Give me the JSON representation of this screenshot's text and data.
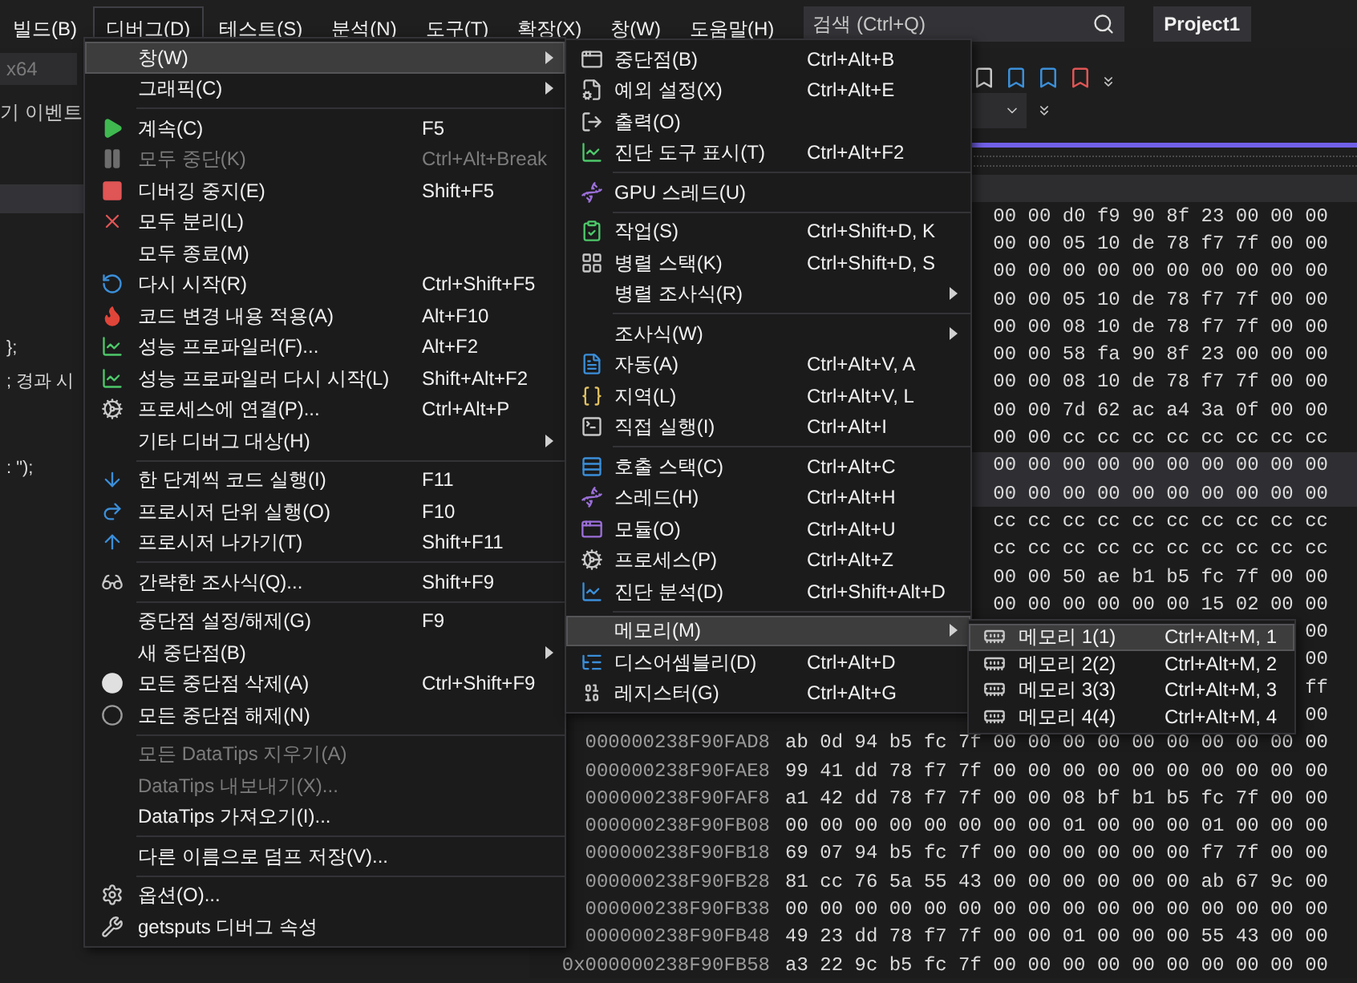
{
  "menubar": {
    "items": [
      {
        "label": "빌드(B)",
        "selected": false
      },
      {
        "label": "디버그(D)",
        "selected": true
      },
      {
        "label": "테스트(S)",
        "selected": false
      },
      {
        "label": "분석(N)",
        "selected": false
      },
      {
        "label": "도구(T)",
        "selected": false
      },
      {
        "label": "확장(X)",
        "selected": false
      },
      {
        "label": "창(W)",
        "selected": false
      },
      {
        "label": "도움말(H)",
        "selected": false
      }
    ],
    "search": {
      "placeholder": "검색 (Ctrl+Q)"
    },
    "project": "Project1"
  },
  "editor": {
    "platform": "x64",
    "event_label": "기 이벤트",
    "code_lines": [
      "};",
      "; 경과 시",
      ": \");"
    ]
  },
  "debug_menu": {
    "items": [
      {
        "kind": "item",
        "label": "창(W)",
        "submenu": true,
        "selected": true,
        "disabled": false
      },
      {
        "kind": "item",
        "label": "그래픽(C)",
        "submenu": true,
        "selected": false,
        "disabled": false
      },
      {
        "kind": "separator"
      },
      {
        "kind": "item",
        "label": "계속(C)",
        "shortcut": "F5",
        "submenu": false,
        "selected": false,
        "disabled": false
      },
      {
        "kind": "item",
        "label": "모두 중단(K)",
        "shortcut": "Ctrl+Alt+Break",
        "submenu": false,
        "selected": false,
        "disabled": true
      },
      {
        "kind": "item",
        "label": "디버깅 중지(E)",
        "shortcut": "Shift+F5",
        "submenu": false,
        "selected": false,
        "disabled": false
      },
      {
        "kind": "item",
        "label": "모두 분리(L)",
        "submenu": false,
        "selected": false,
        "disabled": false
      },
      {
        "kind": "item",
        "label": "모두 종료(M)",
        "submenu": false,
        "selected": false,
        "disabled": false
      },
      {
        "kind": "item",
        "label": "다시 시작(R)",
        "shortcut": "Ctrl+Shift+F5",
        "submenu": false,
        "selected": false,
        "disabled": false
      },
      {
        "kind": "item",
        "label": "코드 변경 내용 적용(A)",
        "shortcut": "Alt+F10",
        "submenu": false,
        "selected": false,
        "disabled": false
      },
      {
        "kind": "item",
        "label": "성능 프로파일러(F)...",
        "shortcut": "Alt+F2",
        "submenu": false,
        "selected": false,
        "disabled": false
      },
      {
        "kind": "item",
        "label": "성능 프로파일러 다시 시작(L)",
        "shortcut": "Shift+Alt+F2",
        "submenu": false,
        "selected": false,
        "disabled": false
      },
      {
        "kind": "item",
        "label": "프로세스에 연결(P)...",
        "shortcut": "Ctrl+Alt+P",
        "submenu": false,
        "selected": false,
        "disabled": false
      },
      {
        "kind": "item",
        "label": "기타 디버그 대상(H)",
        "submenu": true,
        "selected": false,
        "disabled": false
      },
      {
        "kind": "separator"
      },
      {
        "kind": "item",
        "label": "한 단계씩 코드 실행(I)",
        "shortcut": "F11",
        "submenu": false,
        "selected": false,
        "disabled": false
      },
      {
        "kind": "item",
        "label": "프로시저 단위 실행(O)",
        "shortcut": "F10",
        "submenu": false,
        "selected": false,
        "disabled": false
      },
      {
        "kind": "item",
        "label": "프로시저 나가기(T)",
        "shortcut": "Shift+F11",
        "submenu": false,
        "selected": false,
        "disabled": false
      },
      {
        "kind": "separator"
      },
      {
        "kind": "item",
        "label": "간략한 조사식(Q)...",
        "shortcut": "Shift+F9",
        "submenu": false,
        "selected": false,
        "disabled": false
      },
      {
        "kind": "separator"
      },
      {
        "kind": "item",
        "label": "중단점 설정/해제(G)",
        "shortcut": "F9",
        "submenu": false,
        "selected": false,
        "disabled": false
      },
      {
        "kind": "item",
        "label": "새 중단점(B)",
        "submenu": true,
        "selected": false,
        "disabled": false
      },
      {
        "kind": "item",
        "label": "모든 중단점 삭제(A)",
        "shortcut": "Ctrl+Shift+F9",
        "submenu": false,
        "selected": false,
        "disabled": false
      },
      {
        "kind": "item",
        "label": "모든 중단점 해제(N)",
        "submenu": false,
        "selected": false,
        "disabled": false
      },
      {
        "kind": "separator"
      },
      {
        "kind": "item",
        "label": "모든 DataTips 지우기(A)",
        "submenu": false,
        "selected": false,
        "disabled": true
      },
      {
        "kind": "item",
        "label": "DataTips 내보내기(X)...",
        "submenu": false,
        "selected": false,
        "disabled": true
      },
      {
        "kind": "item",
        "label": "DataTips 가져오기(I)...",
        "submenu": false,
        "selected": false,
        "disabled": false
      },
      {
        "kind": "separator"
      },
      {
        "kind": "item",
        "label": "다른 이름으로 덤프 저장(V)...",
        "submenu": false,
        "selected": false,
        "disabled": false
      },
      {
        "kind": "separator"
      },
      {
        "kind": "item",
        "label": "옵션(O)...",
        "submenu": false,
        "selected": false,
        "disabled": false
      },
      {
        "kind": "item",
        "label": "getsputs 디버그 속성",
        "submenu": false,
        "selected": false,
        "disabled": false
      }
    ]
  },
  "window_menu": {
    "items": [
      {
        "kind": "item",
        "label": "중단점(B)",
        "shortcut": "Ctrl+Alt+B",
        "submenu": false,
        "selected": false
      },
      {
        "kind": "item",
        "label": "예외 설정(X)",
        "shortcut": "Ctrl+Alt+E",
        "submenu": false,
        "selected": false
      },
      {
        "kind": "item",
        "label": "출력(O)",
        "submenu": false,
        "selected": false
      },
      {
        "kind": "item",
        "label": "진단 도구 표시(T)",
        "shortcut": "Ctrl+Alt+F2",
        "submenu": false,
        "selected": false
      },
      {
        "kind": "separator"
      },
      {
        "kind": "item",
        "label": "GPU 스레드(U)",
        "submenu": false,
        "selected": false
      },
      {
        "kind": "separator"
      },
      {
        "kind": "item",
        "label": "작업(S)",
        "shortcut": "Ctrl+Shift+D, K",
        "submenu": false,
        "selected": false
      },
      {
        "kind": "item",
        "label": "병렬 스택(K)",
        "shortcut": "Ctrl+Shift+D, S",
        "submenu": false,
        "selected": false
      },
      {
        "kind": "item",
        "label": "병렬 조사식(R)",
        "submenu": true,
        "selected": false
      },
      {
        "kind": "separator"
      },
      {
        "kind": "item",
        "label": "조사식(W)",
        "submenu": true,
        "selected": false
      },
      {
        "kind": "item",
        "label": "자동(A)",
        "shortcut": "Ctrl+Alt+V, A",
        "submenu": false,
        "selected": false
      },
      {
        "kind": "item",
        "label": "지역(L)",
        "shortcut": "Ctrl+Alt+V, L",
        "submenu": false,
        "selected": false
      },
      {
        "kind": "item",
        "label": "직접 실행(I)",
        "shortcut": "Ctrl+Alt+I",
        "submenu": false,
        "selected": false
      },
      {
        "kind": "separator"
      },
      {
        "kind": "item",
        "label": "호출 스택(C)",
        "shortcut": "Ctrl+Alt+C",
        "submenu": false,
        "selected": false
      },
      {
        "kind": "item",
        "label": "스레드(H)",
        "shortcut": "Ctrl+Alt+H",
        "submenu": false,
        "selected": false
      },
      {
        "kind": "item",
        "label": "모듈(O)",
        "shortcut": "Ctrl+Alt+U",
        "submenu": false,
        "selected": false
      },
      {
        "kind": "item",
        "label": "프로세스(P)",
        "shortcut": "Ctrl+Alt+Z",
        "submenu": false,
        "selected": false
      },
      {
        "kind": "item",
        "label": "진단 분석(D)",
        "shortcut": "Ctrl+Shift+Alt+D",
        "submenu": false,
        "selected": false
      },
      {
        "kind": "separator"
      },
      {
        "kind": "item",
        "label": "메모리(M)",
        "submenu": true,
        "selected": true
      },
      {
        "kind": "item",
        "label": "디스어셈블리(D)",
        "shortcut": "Ctrl+Alt+D",
        "submenu": false,
        "selected": false
      },
      {
        "kind": "item",
        "label": "레지스터(G)",
        "shortcut": "Ctrl+Alt+G",
        "submenu": false,
        "selected": false
      }
    ]
  },
  "memory_menu": {
    "items": [
      {
        "kind": "item",
        "label": "메모리 1(1)",
        "shortcut": "Ctrl+Alt+M, 1",
        "selected": true
      },
      {
        "kind": "item",
        "label": "메모리 2(2)",
        "shortcut": "Ctrl+Alt+M, 2",
        "selected": false
      },
      {
        "kind": "item",
        "label": "메모리 3(3)",
        "shortcut": "Ctrl+Alt+M, 3",
        "selected": false
      },
      {
        "kind": "item",
        "label": "메모리 4(4)",
        "shortcut": "Ctrl+Alt+M, 4",
        "selected": false
      }
    ]
  },
  "memory": {
    "rows": [
      {
        "bytes": "00 00 d0 f9 90 8f 23 00 00 00",
        "selected": false
      },
      {
        "bytes": "00 00 05 10 de 78 f7 7f 00 00",
        "selected": false
      },
      {
        "bytes": "00 00 00 00 00 00 00 00 00 00",
        "selected": false
      },
      {
        "bytes": "00 00 05 10 de 78 f7 7f 00 00",
        "selected": false
      },
      {
        "bytes": "00 00 08 10 de 78 f7 7f 00 00",
        "selected": false
      },
      {
        "bytes": "00 00 58 fa 90 8f 23 00 00 00",
        "selected": false
      },
      {
        "bytes": "00 00 08 10 de 78 f7 7f 00 00",
        "selected": false
      },
      {
        "bytes": "00 00 7d 62 ac a4 3a 0f 00 00",
        "selected": false
      },
      {
        "bytes": "00 00 cc cc cc cc cc cc cc cc",
        "selected": false
      },
      {
        "bytes": "00 00 00 00 00 00 00 00 00 00",
        "selected": true
      },
      {
        "bytes": "00 00 00 00 00 00 00 00 00 00",
        "selected": true
      },
      {
        "bytes": "cc cc cc cc cc cc cc cc cc cc",
        "selected": false
      },
      {
        "bytes": "cc cc cc cc cc cc cc cc cc cc",
        "selected": false
      },
      {
        "bytes": "00 00 50 ae b1 b5 fc 7f 00 00",
        "selected": false
      },
      {
        "bytes": "00 00 00 00 00 00 15 02 00 00",
        "selected": false
      },
      {
        "bytes": "00",
        "selected": false
      },
      {
        "bytes": "00",
        "selected": false
      },
      {
        "bytes": "ff",
        "selected": false
      },
      {
        "bytes": "00",
        "selected": false
      },
      {
        "address": "000000238F90FAD8",
        "bytes": "ab 0d 94 b5 fc 7f 00 00 00 00 00 00 00 00 00 00",
        "selected": false
      },
      {
        "address": "000000238F90FAE8",
        "bytes": "99 41 dd 78 f7 7f 00 00 00 00 00 00 00 00 00 00",
        "selected": false
      },
      {
        "address": "000000238F90FAF8",
        "bytes": "a1 42 dd 78 f7 7f 00 00 08 bf b1 b5 fc 7f 00 00",
        "selected": false
      },
      {
        "address": "000000238F90FB08",
        "bytes": "00 00 00 00 00 00 00 00 01 00 00 00 01 00 00 00",
        "selected": false
      },
      {
        "address": "000000238F90FB18",
        "bytes": "69 07 94 b5 fc 7f 00 00 00 00 00 00 f7 7f 00 00",
        "selected": false
      },
      {
        "address": "000000238F90FB28",
        "bytes": "81 cc 76 5a 55 43 00 00 00 00 00 00 ab 67 9c 00",
        "selected": false
      },
      {
        "address": "000000238F90FB38",
        "bytes": "00 00 00 00 00 00 00 00 00 00 00 00 00 00 00 00",
        "selected": false
      },
      {
        "address": "000000238F90FB48",
        "bytes": "49 23 dd 78 f7 7f 00 00 01 00 00 00 55 43 00 00",
        "selected": false
      },
      {
        "address": "0x000000238F90FB58",
        "bytes": "a3 22 9c b5 fc 7f 00 00 00 00 00 00 00 00 00 00",
        "selected": false
      }
    ]
  }
}
